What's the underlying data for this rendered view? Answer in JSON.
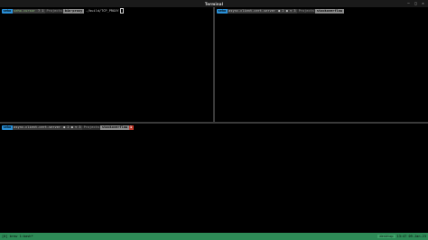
{
  "window": {
    "title": "Terminal"
  },
  "panes": {
    "left": {
      "user": "seho",
      "host": "seho-cursor",
      "git_status": "? 1",
      "path_parent": "Projects",
      "path_current": "bin-proxy",
      "command": "./build/TCP_PROXY"
    },
    "right": {
      "user": "seho",
      "host": "async-client-cert-server",
      "git_status": "● 2 ● ▽ 3",
      "path_parent": "Projects",
      "path_current": "stackoverflow"
    },
    "bottom": {
      "user": "seho",
      "host": "async-client-cert-server",
      "git_status": "● 2 ● ▽ 3",
      "path_parent": "Projects",
      "path_current": "stackoverflow",
      "exit_status": "1"
    }
  },
  "statusbar": {
    "left_text": "[0] brew  1:bash*",
    "host": "desktop",
    "clock": "13:47 09-Jan-23"
  },
  "colors": {
    "user_segment": "#2a8fd6",
    "host_text": "#8ec07c",
    "error_segment": "#c0392b",
    "statusbar": "#2e8b57"
  }
}
